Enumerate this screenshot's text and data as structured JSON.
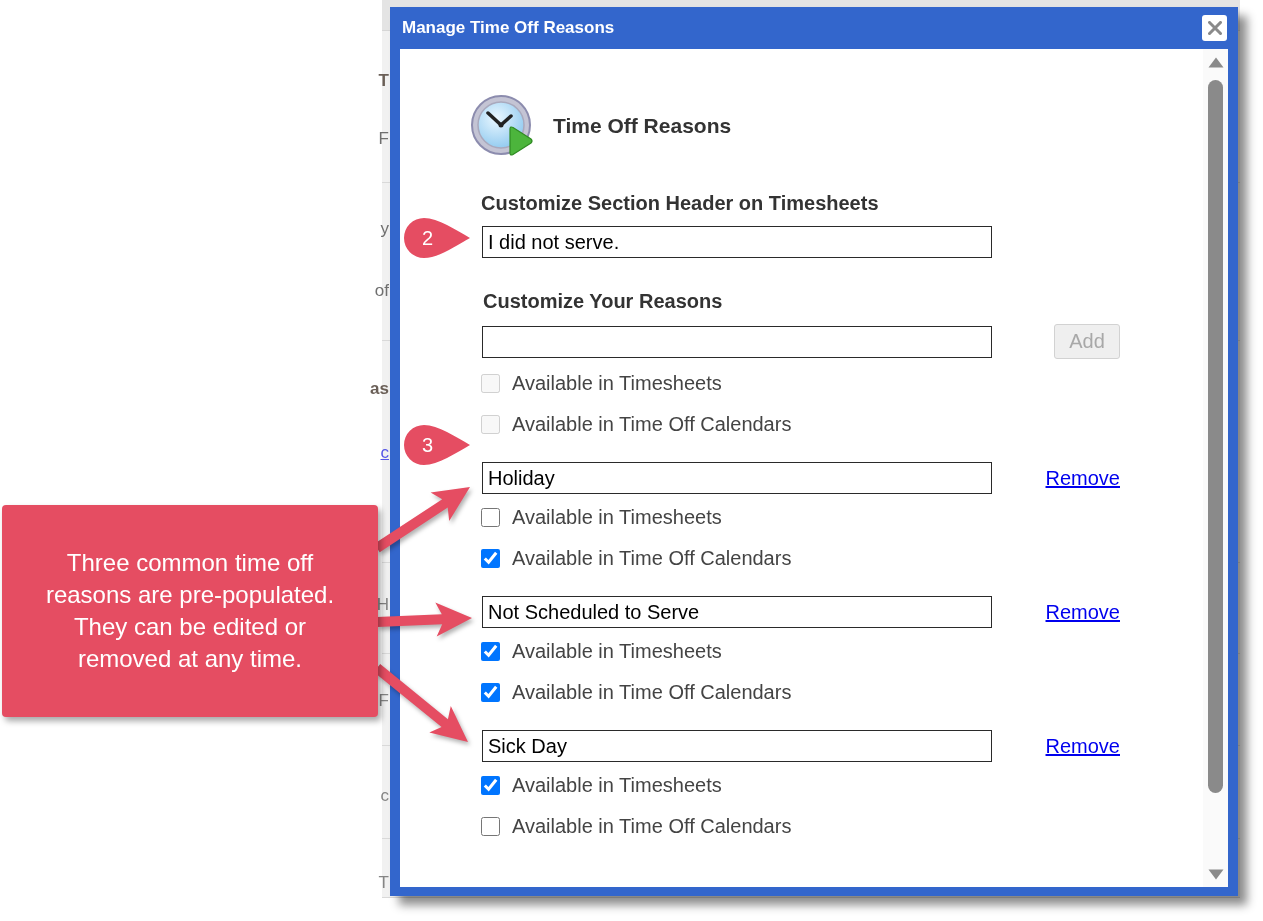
{
  "background_page": {
    "sections": [
      {
        "lines": [
          {
            "text": "T",
            "kind": "heading"
          },
          {
            "text": "F",
            "kind": "text"
          }
        ]
      },
      {
        "lines": [
          {
            "text": "y",
            "kind": "text"
          },
          {
            "text": "of",
            "kind": "text"
          }
        ]
      },
      {
        "lines": [
          {
            "text": "as",
            "kind": "heading"
          },
          {
            "text": "c",
            "kind": "link"
          }
        ]
      },
      {
        "lines": [
          {
            "text": "H",
            "kind": "faint"
          }
        ]
      },
      {
        "lines": [
          {
            "text": "F",
            "kind": "faint"
          }
        ]
      },
      {
        "lines": [
          {
            "text": "c",
            "kind": "faint"
          }
        ]
      },
      {
        "lines": [
          {
            "text": "T",
            "kind": "faint"
          }
        ]
      }
    ]
  },
  "dialog": {
    "title": "Manage Time Off Reasons",
    "heading": "Time Off Reasons",
    "section_header": {
      "label": "Customize Section Header on Timesheets",
      "value": "I did not serve."
    },
    "new_reason": {
      "label": "Customize Your Reasons",
      "add_button": {
        "label": "Add",
        "disabled": true
      },
      "options": [
        {
          "label": "Available in Timesheets",
          "checked": false,
          "disabled": true
        },
        {
          "label": "Available in Time Off Calendars",
          "checked": false,
          "disabled": true
        }
      ]
    },
    "reasons": [
      {
        "value": "Holiday",
        "remove_link": "Remove",
        "options": [
          {
            "label": "Available in Timesheets",
            "checked": false,
            "disabled": false
          },
          {
            "label": "Available in Time Off Calendars",
            "checked": true,
            "disabled": false
          }
        ]
      },
      {
        "value": "Not Scheduled to Serve",
        "remove_link": "Remove",
        "options": [
          {
            "label": "Available in Timesheets",
            "checked": true,
            "disabled": false
          },
          {
            "label": "Available in Time Off Calendars",
            "checked": true,
            "disabled": false
          }
        ]
      },
      {
        "value": "Sick Day",
        "remove_link": "Remove",
        "options": [
          {
            "label": "Available in Timesheets",
            "checked": true,
            "disabled": false
          },
          {
            "label": "Available in Time Off Calendars",
            "checked": false,
            "disabled": false
          }
        ]
      }
    ]
  },
  "annotations": {
    "markers": [
      {
        "label": "2"
      },
      {
        "label": "3"
      }
    ],
    "callout": {
      "text": "Three common time off reasons are pre-populated. They can be edited or removed at any time."
    }
  }
}
